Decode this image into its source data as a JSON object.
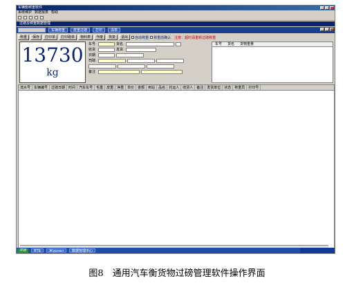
{
  "window": {
    "title": "车辆衡称重软件"
  },
  "menu": [
    "系统维护",
    "数据报表",
    "帮助"
  ],
  "inner_title": "过磅及称重数据管理",
  "tabs": [
    "车辆称重",
    "皮重过磅",
    "打印",
    "清单"
  ],
  "ops": [
    "称重",
    "保存",
    "打印单",
    "打印磅单",
    "物料表",
    "作废",
    "恢复",
    "退出"
  ],
  "checks": [
    "自动称重",
    "称重前确认"
  ],
  "notice": "注意：超时请重新过磅称重",
  "weight": {
    "value": "13730",
    "unit": "kg"
  },
  "form_labels": [
    "车号",
    "货名",
    "收货",
    "发货",
    "日期",
    "司磅",
    "备注"
  ],
  "right_table": {
    "headers": [
      "车号",
      "货名",
      "货物重量"
    ]
  },
  "grid_headers": [
    "流水号",
    "车辆编号",
    "过磅日期",
    "时间",
    "汽车车号",
    "毛重",
    "皮重",
    "净重",
    "单价",
    "金额",
    "到站",
    "品名",
    "托运人",
    "收货人",
    "备注",
    "发货单位",
    "状态",
    "称重员",
    "打印号"
  ],
  "taskbar": {
    "start": "开始",
    "items": [
      "ВТБ",
      "Журнал",
      "数据管理中心"
    ]
  },
  "caption": "图8　通用汽车衡货物过磅管理软件操作界面"
}
